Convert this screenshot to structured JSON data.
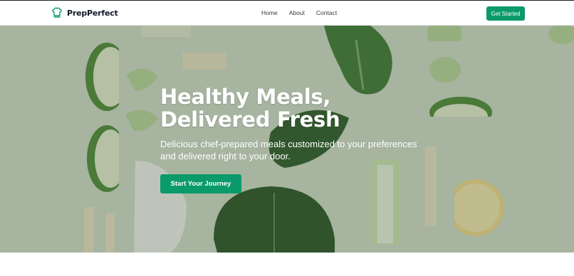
{
  "brand": {
    "name": "PrepPerfect",
    "icon": "chef-hat-icon"
  },
  "nav": {
    "links": [
      "Home",
      "About",
      "Contact"
    ],
    "cta_label": "Get Started"
  },
  "hero": {
    "title_line1": "Healthy Meals,",
    "title_line2": "Delivered Fresh",
    "subtitle": "Delicious chef-prepared meals customized to your preferences and delivered right to your door.",
    "cta_label": "Start Your Journey",
    "background": "vegetables-photo"
  },
  "colors": {
    "accent": "#0b9a6b",
    "hero_tint": "#c9d7c4"
  }
}
